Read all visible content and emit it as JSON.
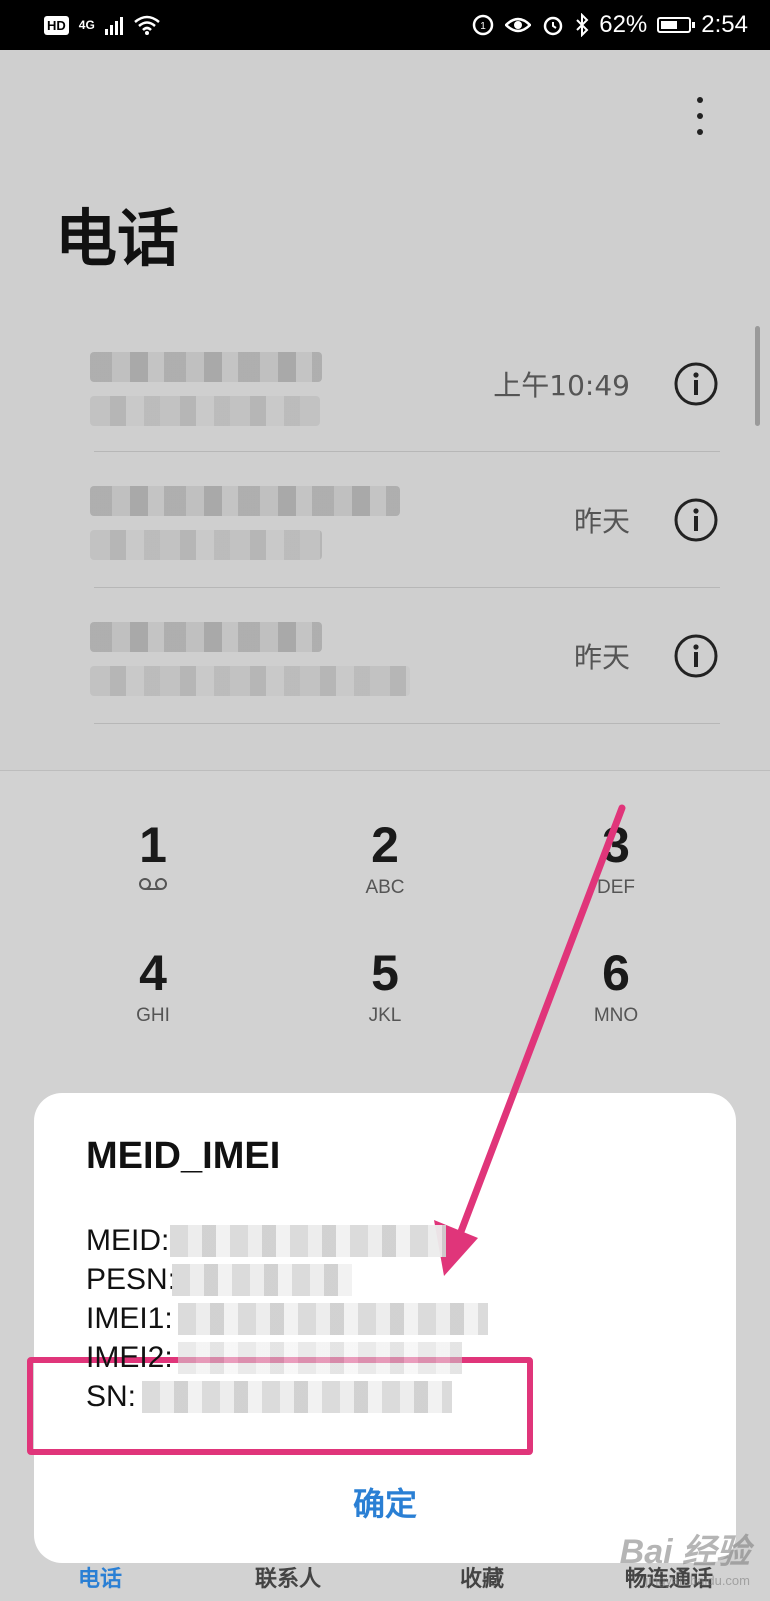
{
  "status_bar": {
    "left_badge": "HD",
    "network": "4G",
    "battery_percent": "62%",
    "battery_level": 0.62,
    "time": "2:54"
  },
  "header": {
    "title": "电话",
    "menu_icon": "more-vertical-icon"
  },
  "call_log": [
    {
      "time": "上午10:49",
      "icon": "info-icon"
    },
    {
      "time": "昨天",
      "icon": "info-icon"
    },
    {
      "time": "昨天",
      "icon": "info-icon"
    }
  ],
  "dialpad": {
    "keys": [
      {
        "num": "1",
        "letters": ""
      },
      {
        "num": "2",
        "letters": "ABC"
      },
      {
        "num": "3",
        "letters": "DEF"
      },
      {
        "num": "4",
        "letters": "GHI"
      },
      {
        "num": "5",
        "letters": "JKL"
      },
      {
        "num": "6",
        "letters": "MNO"
      }
    ]
  },
  "dialog": {
    "title": "MEID_IMEI",
    "lines": [
      {
        "label": "MEID:"
      },
      {
        "label": "PESN:"
      },
      {
        "label": "IMEI1:"
      },
      {
        "label": "IMEI2:"
      },
      {
        "label": "SN:"
      }
    ],
    "ok_label": "确定"
  },
  "bottom_nav": {
    "items": [
      "电话",
      "联系人",
      "收藏",
      "畅连通话"
    ]
  },
  "annotation": {
    "color": "#e0357a"
  },
  "watermark": {
    "brand": "Bai 经验",
    "url": "jingyan.baidu.com"
  }
}
